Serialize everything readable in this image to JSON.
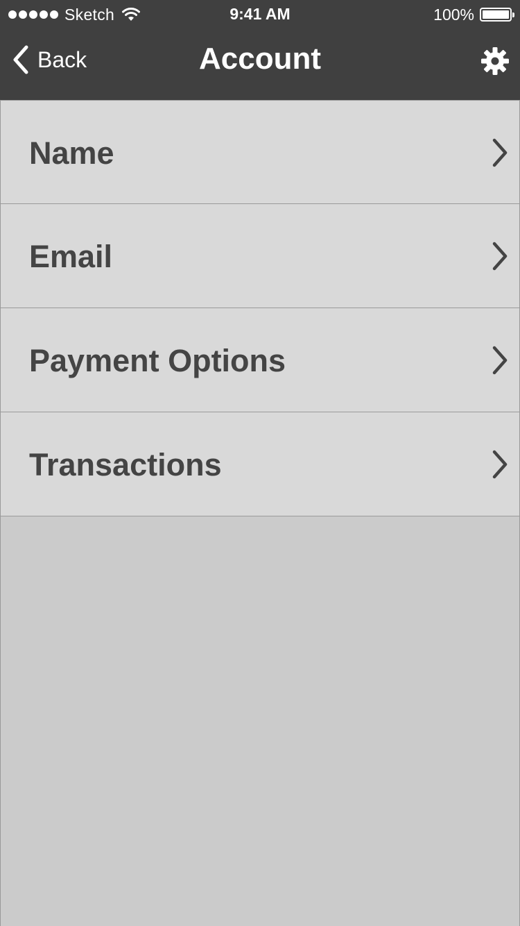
{
  "status_bar": {
    "carrier": "Sketch",
    "time": "9:41 AM",
    "battery_percent": "100%",
    "signal_icon": "signal-dots-icon",
    "wifi_icon": "wifi-icon",
    "battery_icon": "battery-icon"
  },
  "nav": {
    "back_label": "Back",
    "back_icon": "chevron-left-icon",
    "title": "Account",
    "settings_icon": "gear-icon"
  },
  "menu": {
    "items": [
      {
        "label": "Name"
      },
      {
        "label": "Email"
      },
      {
        "label": "Payment Options"
      },
      {
        "label": "Transactions"
      }
    ],
    "chevron_icon": "chevron-right-icon"
  },
  "colors": {
    "header_bg": "#404040",
    "row_bg": "#d9d9d9",
    "page_bg": "#cbcbcb",
    "text": "#444444"
  }
}
